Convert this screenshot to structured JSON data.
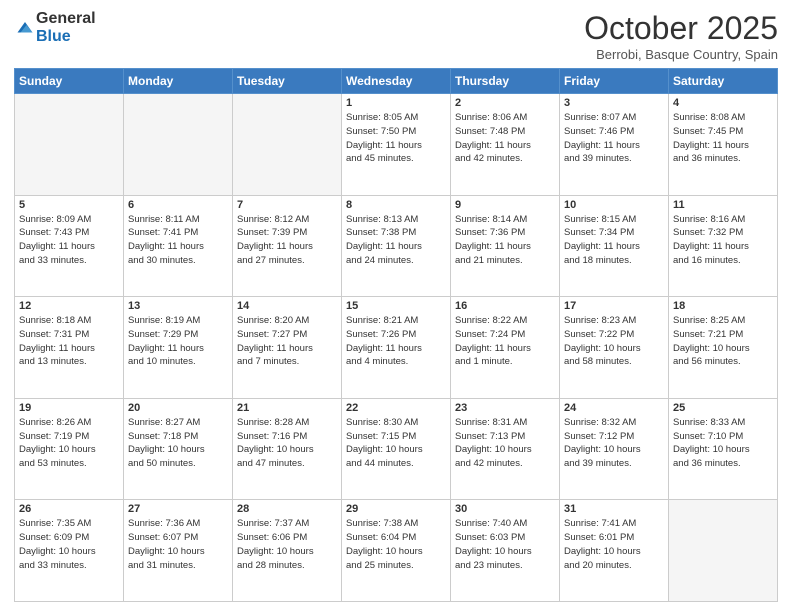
{
  "logo": {
    "general": "General",
    "blue": "Blue"
  },
  "header": {
    "month": "October 2025",
    "location": "Berrobi, Basque Country, Spain"
  },
  "weekdays": [
    "Sunday",
    "Monday",
    "Tuesday",
    "Wednesday",
    "Thursday",
    "Friday",
    "Saturday"
  ],
  "weeks": [
    [
      {
        "day": "",
        "info": ""
      },
      {
        "day": "",
        "info": ""
      },
      {
        "day": "",
        "info": ""
      },
      {
        "day": "1",
        "info": "Sunrise: 8:05 AM\nSunset: 7:50 PM\nDaylight: 11 hours\nand 45 minutes."
      },
      {
        "day": "2",
        "info": "Sunrise: 8:06 AM\nSunset: 7:48 PM\nDaylight: 11 hours\nand 42 minutes."
      },
      {
        "day": "3",
        "info": "Sunrise: 8:07 AM\nSunset: 7:46 PM\nDaylight: 11 hours\nand 39 minutes."
      },
      {
        "day": "4",
        "info": "Sunrise: 8:08 AM\nSunset: 7:45 PM\nDaylight: 11 hours\nand 36 minutes."
      }
    ],
    [
      {
        "day": "5",
        "info": "Sunrise: 8:09 AM\nSunset: 7:43 PM\nDaylight: 11 hours\nand 33 minutes."
      },
      {
        "day": "6",
        "info": "Sunrise: 8:11 AM\nSunset: 7:41 PM\nDaylight: 11 hours\nand 30 minutes."
      },
      {
        "day": "7",
        "info": "Sunrise: 8:12 AM\nSunset: 7:39 PM\nDaylight: 11 hours\nand 27 minutes."
      },
      {
        "day": "8",
        "info": "Sunrise: 8:13 AM\nSunset: 7:38 PM\nDaylight: 11 hours\nand 24 minutes."
      },
      {
        "day": "9",
        "info": "Sunrise: 8:14 AM\nSunset: 7:36 PM\nDaylight: 11 hours\nand 21 minutes."
      },
      {
        "day": "10",
        "info": "Sunrise: 8:15 AM\nSunset: 7:34 PM\nDaylight: 11 hours\nand 18 minutes."
      },
      {
        "day": "11",
        "info": "Sunrise: 8:16 AM\nSunset: 7:32 PM\nDaylight: 11 hours\nand 16 minutes."
      }
    ],
    [
      {
        "day": "12",
        "info": "Sunrise: 8:18 AM\nSunset: 7:31 PM\nDaylight: 11 hours\nand 13 minutes."
      },
      {
        "day": "13",
        "info": "Sunrise: 8:19 AM\nSunset: 7:29 PM\nDaylight: 11 hours\nand 10 minutes."
      },
      {
        "day": "14",
        "info": "Sunrise: 8:20 AM\nSunset: 7:27 PM\nDaylight: 11 hours\nand 7 minutes."
      },
      {
        "day": "15",
        "info": "Sunrise: 8:21 AM\nSunset: 7:26 PM\nDaylight: 11 hours\nand 4 minutes."
      },
      {
        "day": "16",
        "info": "Sunrise: 8:22 AM\nSunset: 7:24 PM\nDaylight: 11 hours\nand 1 minute."
      },
      {
        "day": "17",
        "info": "Sunrise: 8:23 AM\nSunset: 7:22 PM\nDaylight: 10 hours\nand 58 minutes."
      },
      {
        "day": "18",
        "info": "Sunrise: 8:25 AM\nSunset: 7:21 PM\nDaylight: 10 hours\nand 56 minutes."
      }
    ],
    [
      {
        "day": "19",
        "info": "Sunrise: 8:26 AM\nSunset: 7:19 PM\nDaylight: 10 hours\nand 53 minutes."
      },
      {
        "day": "20",
        "info": "Sunrise: 8:27 AM\nSunset: 7:18 PM\nDaylight: 10 hours\nand 50 minutes."
      },
      {
        "day": "21",
        "info": "Sunrise: 8:28 AM\nSunset: 7:16 PM\nDaylight: 10 hours\nand 47 minutes."
      },
      {
        "day": "22",
        "info": "Sunrise: 8:30 AM\nSunset: 7:15 PM\nDaylight: 10 hours\nand 44 minutes."
      },
      {
        "day": "23",
        "info": "Sunrise: 8:31 AM\nSunset: 7:13 PM\nDaylight: 10 hours\nand 42 minutes."
      },
      {
        "day": "24",
        "info": "Sunrise: 8:32 AM\nSunset: 7:12 PM\nDaylight: 10 hours\nand 39 minutes."
      },
      {
        "day": "25",
        "info": "Sunrise: 8:33 AM\nSunset: 7:10 PM\nDaylight: 10 hours\nand 36 minutes."
      }
    ],
    [
      {
        "day": "26",
        "info": "Sunrise: 7:35 AM\nSunset: 6:09 PM\nDaylight: 10 hours\nand 33 minutes."
      },
      {
        "day": "27",
        "info": "Sunrise: 7:36 AM\nSunset: 6:07 PM\nDaylight: 10 hours\nand 31 minutes."
      },
      {
        "day": "28",
        "info": "Sunrise: 7:37 AM\nSunset: 6:06 PM\nDaylight: 10 hours\nand 28 minutes."
      },
      {
        "day": "29",
        "info": "Sunrise: 7:38 AM\nSunset: 6:04 PM\nDaylight: 10 hours\nand 25 minutes."
      },
      {
        "day": "30",
        "info": "Sunrise: 7:40 AM\nSunset: 6:03 PM\nDaylight: 10 hours\nand 23 minutes."
      },
      {
        "day": "31",
        "info": "Sunrise: 7:41 AM\nSunset: 6:01 PM\nDaylight: 10 hours\nand 20 minutes."
      },
      {
        "day": "",
        "info": ""
      }
    ]
  ]
}
